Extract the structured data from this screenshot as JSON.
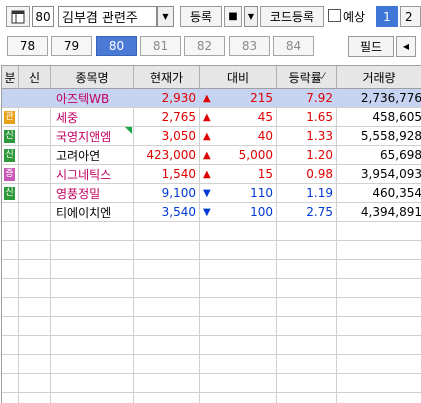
{
  "toolbar": {
    "screen_number": "80",
    "theme_value": "김부겸 관련주",
    "register_label": "등록",
    "code_register_label": "코드등록",
    "expected_label": "예상",
    "page_tabs": [
      "1",
      "2"
    ]
  },
  "tabs": [
    "78",
    "79",
    "80",
    "81",
    "82",
    "83",
    "84"
  ],
  "active_tab": "80",
  "field_label": "필드",
  "columns": {
    "category": "분",
    "credit": "신",
    "name": "종목명",
    "price": "현재가",
    "change": "대비",
    "rate": "등락률",
    "volume": "거래량"
  },
  "colors": {
    "up": "#e00000",
    "down": "#0039d6",
    "selected_row": "#c6d4f2",
    "badge_mgmt": "#e8a01b",
    "badge_credit": "#2e9a3a",
    "badge_warn": "#c858b8"
  },
  "rows": [
    {
      "badge": "",
      "name": "아즈텍WB",
      "name_color": "#c00060",
      "price": "2,930",
      "dir": "up",
      "change": "215",
      "rate": "7.92",
      "volume": "2,736,776",
      "selected": true
    },
    {
      "badge": "관",
      "badge_color": "#e8a01b",
      "name": "세중",
      "name_color": "#c00060",
      "price": "2,765",
      "dir": "up",
      "change": "45",
      "rate": "1.65",
      "volume": "458,605"
    },
    {
      "badge": "신",
      "badge_color": "#2e9a3a",
      "name": "국영지앤엠",
      "name_color": "#c00060",
      "price": "3,050",
      "dir": "up",
      "change": "40",
      "rate": "1.33",
      "volume": "5,558,928"
    },
    {
      "badge": "신",
      "badge_color": "#2e9a3a",
      "name": "고려아연",
      "name_color": "#000000",
      "price": "423,000",
      "dir": "up",
      "change": "5,000",
      "rate": "1.20",
      "volume": "65,698"
    },
    {
      "badge": "증",
      "badge_color": "#c858b8",
      "name": "시그네틱스",
      "name_color": "#c00060",
      "price": "1,540",
      "dir": "up",
      "change": "15",
      "rate": "0.98",
      "volume": "3,954,093"
    },
    {
      "badge": "신",
      "badge_color": "#2e9a3a",
      "name": "영풍정밀",
      "name_color": "#c00060",
      "price": "9,100",
      "dir": "down",
      "change": "110",
      "rate": "1.19",
      "volume": "460,354"
    },
    {
      "badge": "",
      "name": "티에이치엔",
      "name_color": "#000000",
      "price": "3,540",
      "dir": "down",
      "change": "100",
      "rate": "2.75",
      "volume": "4,394,891"
    }
  ]
}
